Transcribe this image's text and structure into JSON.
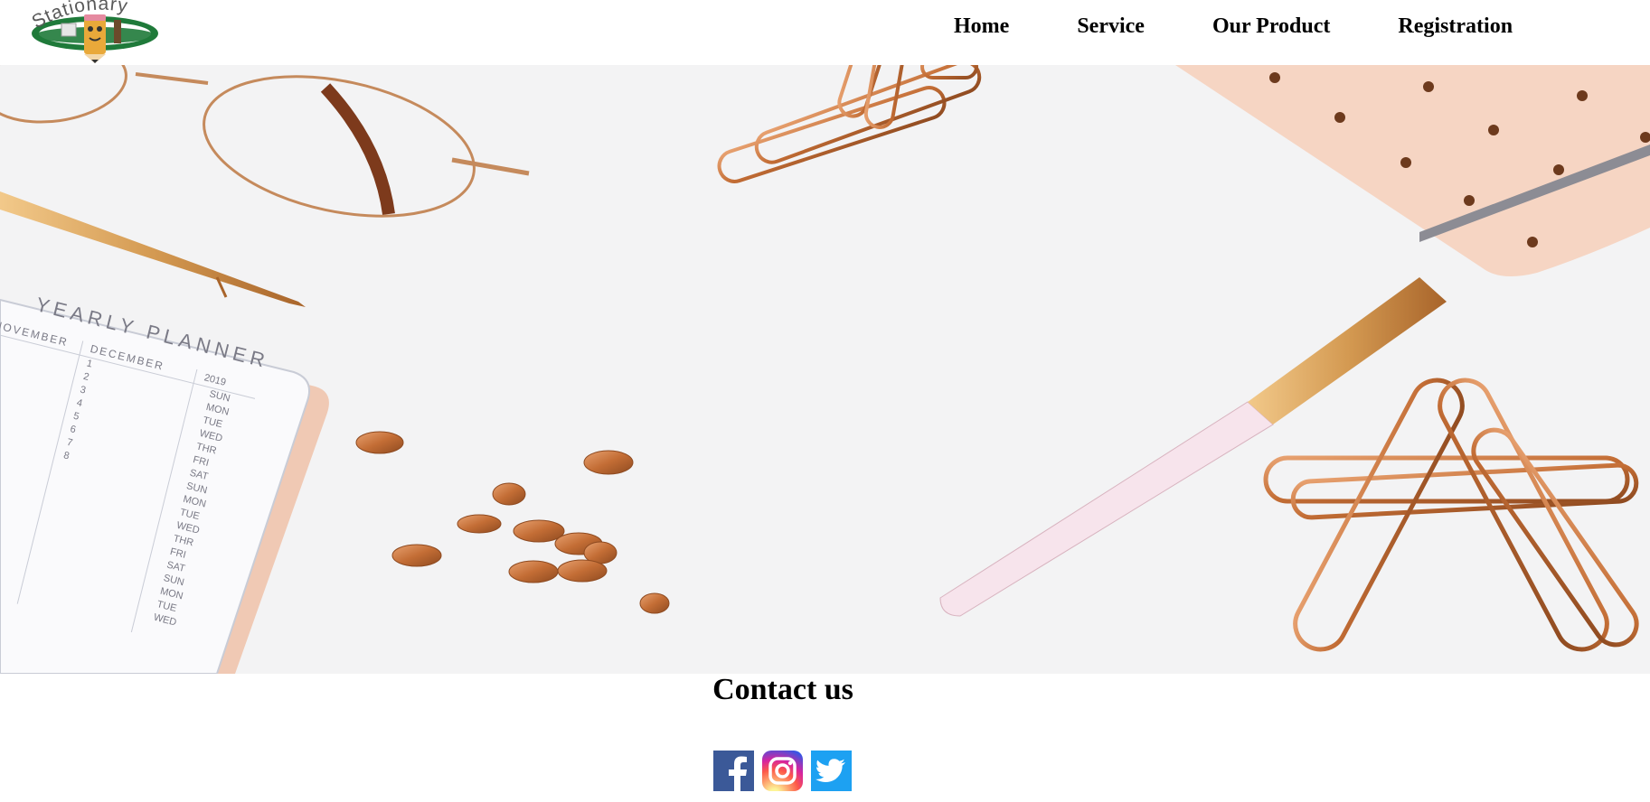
{
  "logo": {
    "text": "Stationary",
    "icon": "pencil-mascot-logo",
    "colors": {
      "oval": "#1f7a3a",
      "pencil": "#e9a93a"
    }
  },
  "nav": {
    "items": [
      {
        "label": "Home"
      },
      {
        "label": "Service"
      },
      {
        "label": "Our Product"
      },
      {
        "label": "Registration"
      }
    ]
  },
  "hero": {
    "image": "rose-gold-stationery-desk-photo",
    "planner": {
      "title": "YEARLY PLANNER",
      "months": [
        "NOVEMBER",
        "DECEMBER"
      ],
      "year": "2019",
      "days": [
        "SUN",
        "MON",
        "TUE",
        "WED",
        "THR",
        "FRI",
        "SAT",
        "SUN",
        "MON",
        "TUE",
        "WED",
        "THR",
        "FRI",
        "SAT",
        "SUN",
        "MON",
        "TUE",
        "WED"
      ],
      "numbers": [
        "1",
        "2",
        "3",
        "4",
        "5",
        "6",
        "7",
        "8"
      ]
    },
    "colors": {
      "rose_gold": "#c8733a",
      "notebook": "#f6d5c3",
      "background": "#f3f3f4"
    }
  },
  "contact": {
    "heading": "Contact us",
    "social": [
      {
        "name": "Facebook",
        "icon": "facebook-icon",
        "color": "#3b5998"
      },
      {
        "name": "Instagram",
        "icon": "instagram-icon",
        "color": "#d6249f"
      },
      {
        "name": "Twitter",
        "icon": "twitter-icon",
        "color": "#1da1f2"
      }
    ]
  }
}
